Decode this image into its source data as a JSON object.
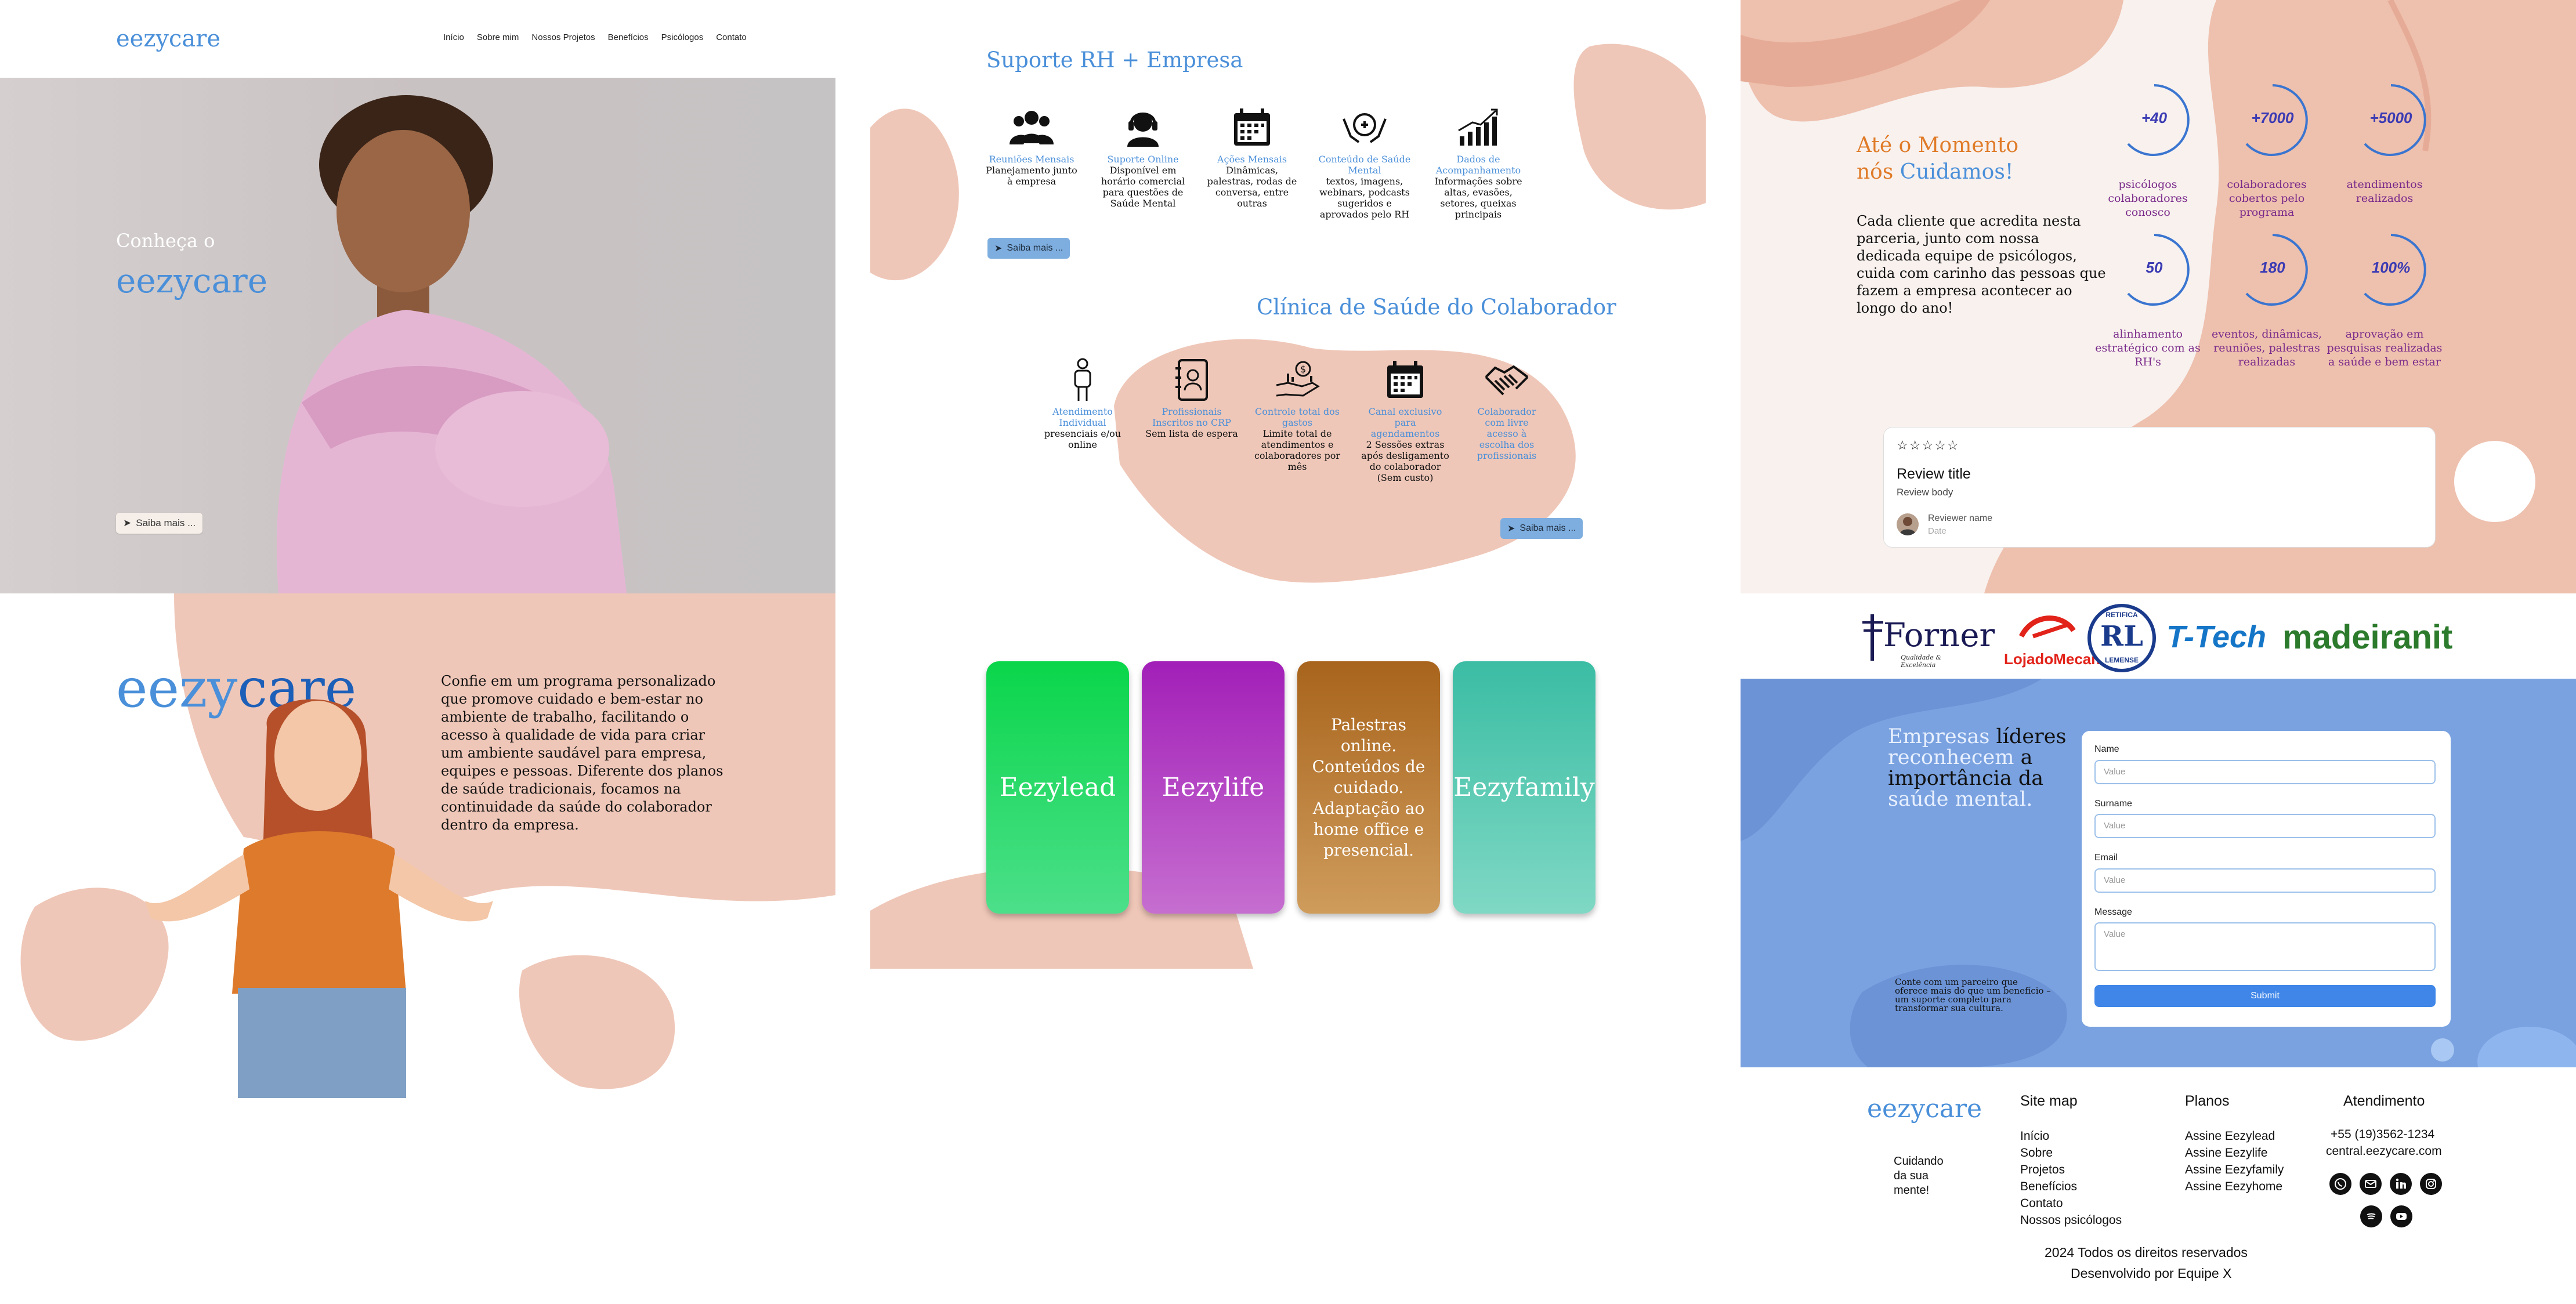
{
  "brand": "eezycare",
  "nav": [
    "Início",
    "Sobre mim",
    "Nossos Projetos",
    "Benefícios",
    "Psicólogos",
    "Contato"
  ],
  "hero": {
    "line1": "Conheça o",
    "line2": "eezycare",
    "button": "Saiba mais ..."
  },
  "about": {
    "logo_a": "eezy",
    "logo_b": "care",
    "text": "Confie em um programa personalizado que promove cuidado e bem-estar no ambiente de trabalho, facilitando o acesso à qualidade de vida para criar um ambiente saudável para empresa, equipes e pessoas. Diferente dos planos de saúde tradicionais, focamos na continuidade da saúde do colaborador dentro da empresa."
  },
  "rh": {
    "title": "Suporte RH + Empresa",
    "items": [
      {
        "icon": "group-icon",
        "title": "Reuniões Mensais",
        "desc": "Planejamento junto à empresa"
      },
      {
        "icon": "headset-icon",
        "title": "Suporte Online",
        "desc": "Disponível em horário comercial para questões de Saúde Mental"
      },
      {
        "icon": "calendar-icon",
        "title": "Ações Mensais",
        "desc": "Dinâmicas, palestras, rodas de conversa, entre outras"
      },
      {
        "icon": "head-hands-icon",
        "title": "Conteúdo de Saúde Mental",
        "desc": "textos, imagens, webinars, podcasts sugeridos e aprovados pelo RH"
      },
      {
        "icon": "growth-chart-icon",
        "title": "Dados de Acompanhamento",
        "desc": "Informações sobre altas, evasões, setores, queixas principais"
      }
    ],
    "button": "Saiba mais ..."
  },
  "clinic": {
    "title": "Clínica de Saúde do Colaborador",
    "items": [
      {
        "icon": "person-icon",
        "title": "Atendimento Individual",
        "desc": "presenciais e/ou online"
      },
      {
        "icon": "address-book-icon",
        "title": "Profissionais Inscritos no CRP",
        "desc": "Sem lista de espera"
      },
      {
        "icon": "hand-money-icon",
        "title": "Controle total dos gastos",
        "desc": "Limite total de atendimentos e colaboradores por mês"
      },
      {
        "icon": "calendar-icon",
        "title": "Canal exclusivo para agendamentos",
        "desc": "2 Sessões extras após desligamento do colaborador (Sem custo)"
      },
      {
        "icon": "handshake-icon",
        "title": "Colaborador com livre acesso à escolha dos profissionais",
        "desc": ""
      }
    ],
    "button": "Saiba mais ..."
  },
  "plans": [
    {
      "label": "Eezylead",
      "color_top": "#0ad64a",
      "color_bottom": "#4cdf8a"
    },
    {
      "label": "Eezylife",
      "color_top": "#a21fb8",
      "color_bottom": "#c66ed0"
    },
    {
      "label": "Palestras online. Conteúdos de cuidado. Adaptação ao home office e presencial.",
      "color_top": "#a8641c",
      "color_bottom": "#cf9c5c"
    },
    {
      "label": "Eezyfamily",
      "color_top": "#3bbda4",
      "color_bottom": "#7fd8c4"
    }
  ],
  "stats": {
    "title_a": "Até o Momento",
    "title_b": "nós",
    "title_c": "Cuidamos!",
    "text": "Cada cliente que acredita nesta parceria, junto com nossa dedicada equipe de psicólogos, cuida com carinho das pessoas que fazem a empresa acontecer ao longo do ano!",
    "items": [
      {
        "value": "+40",
        "label": "psicólogos colaboradores conosco"
      },
      {
        "value": "+7000",
        "label": "colaboradores cobertos pelo programa"
      },
      {
        "value": "+5000",
        "label": "atendimentos realizados"
      },
      {
        "value": "50",
        "label": "alinhamento estratégico com as RH's"
      },
      {
        "value": "180",
        "label": "eventos, dinâmicas, reuniões, palestras realizadas"
      },
      {
        "value": "100%",
        "label": "aprovação em pesquisas realizadas a saúde e bem estar"
      }
    ]
  },
  "review": {
    "stars": "☆☆☆☆☆",
    "title": "Review title",
    "body": "Review body",
    "name": "Reviewer name",
    "date": "Date"
  },
  "partners": [
    "Forner",
    "LojadoMecanico",
    "RL",
    "T-Tech",
    "madeiranit"
  ],
  "partner_sub": {
    "forner": "Qualidade & Excelência",
    "rl_top": "RETIFICA",
    "rl_bottom": "LEMENSE"
  },
  "contact": {
    "h1": "Empresas",
    "h2": "líderes",
    "h3": "reconhecem",
    "h4": "a",
    "h5": "importância",
    "h6": "da",
    "h7": "saúde",
    "h8": "mental.",
    "small": "Conte com um parceiro que oferece mais do que um benefício – um suporte completo para transformar sua cultura.",
    "fields": {
      "name": "Name",
      "surname": "Surname",
      "email": "Email",
      "message": "Message",
      "placeholder": "Value",
      "submit": "Submit"
    }
  },
  "footer": {
    "brand": "eezycare",
    "tagline": "Cuidando da sua mente!",
    "sitemap_title": "Site map",
    "sitemap": [
      "Início",
      "Sobre",
      "Projetos",
      "Benefícios",
      "Contato",
      "Nossos psicólogos"
    ],
    "planos_title": "Planos",
    "planos": [
      "Assine Eezylead",
      "Assine Eezylife",
      "Assine Eezyfamily",
      "Assine Eezyhome"
    ],
    "atend_title": "Atendimento",
    "phone": "+55 (19)3562-1234",
    "site": "central.eezycare.com",
    "copyright": "2024 Todos os direitos reservados",
    "dev": "Desenvolvido por Equipe X"
  },
  "colors": {
    "accent": "#4a8fd9",
    "peach": "#efc3b2",
    "form_bg": "#7aa2e0",
    "purple": "#7a2a8a",
    "orange": "#e07b28"
  }
}
